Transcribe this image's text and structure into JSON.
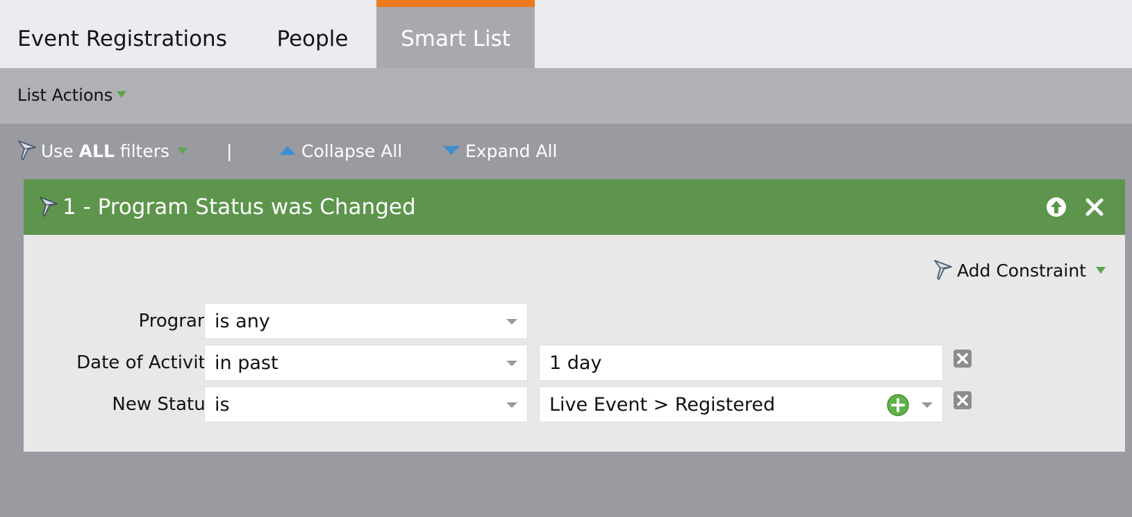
{
  "tabs": [
    {
      "label": "Event Registrations",
      "active": false
    },
    {
      "label": "People",
      "active": false
    },
    {
      "label": "Smart List",
      "active": true
    }
  ],
  "list_actions": {
    "label": "List Actions"
  },
  "toolbar": {
    "use_prefix": "Use",
    "use_bold": "ALL",
    "use_suffix": "filters",
    "separator": "|",
    "collapse_all": "Collapse All",
    "expand_all": "Expand All"
  },
  "filter": {
    "title": "1 - Program Status was Changed",
    "add_constraint": "Add Constraint",
    "rows": [
      {
        "label": "Program:",
        "operator": "is any"
      },
      {
        "label": "Date of Activity:",
        "operator": "in past",
        "value": "1 day"
      },
      {
        "label": "New Status:",
        "operator": "is",
        "value": "Live Event > Registered"
      }
    ]
  },
  "colors": {
    "active_tab_accent": "#ec7a1b",
    "filter_header": "#5d954c",
    "dropdown_triangle": "#5ea64a",
    "collapse_expand_icon": "#3d8fd0"
  }
}
